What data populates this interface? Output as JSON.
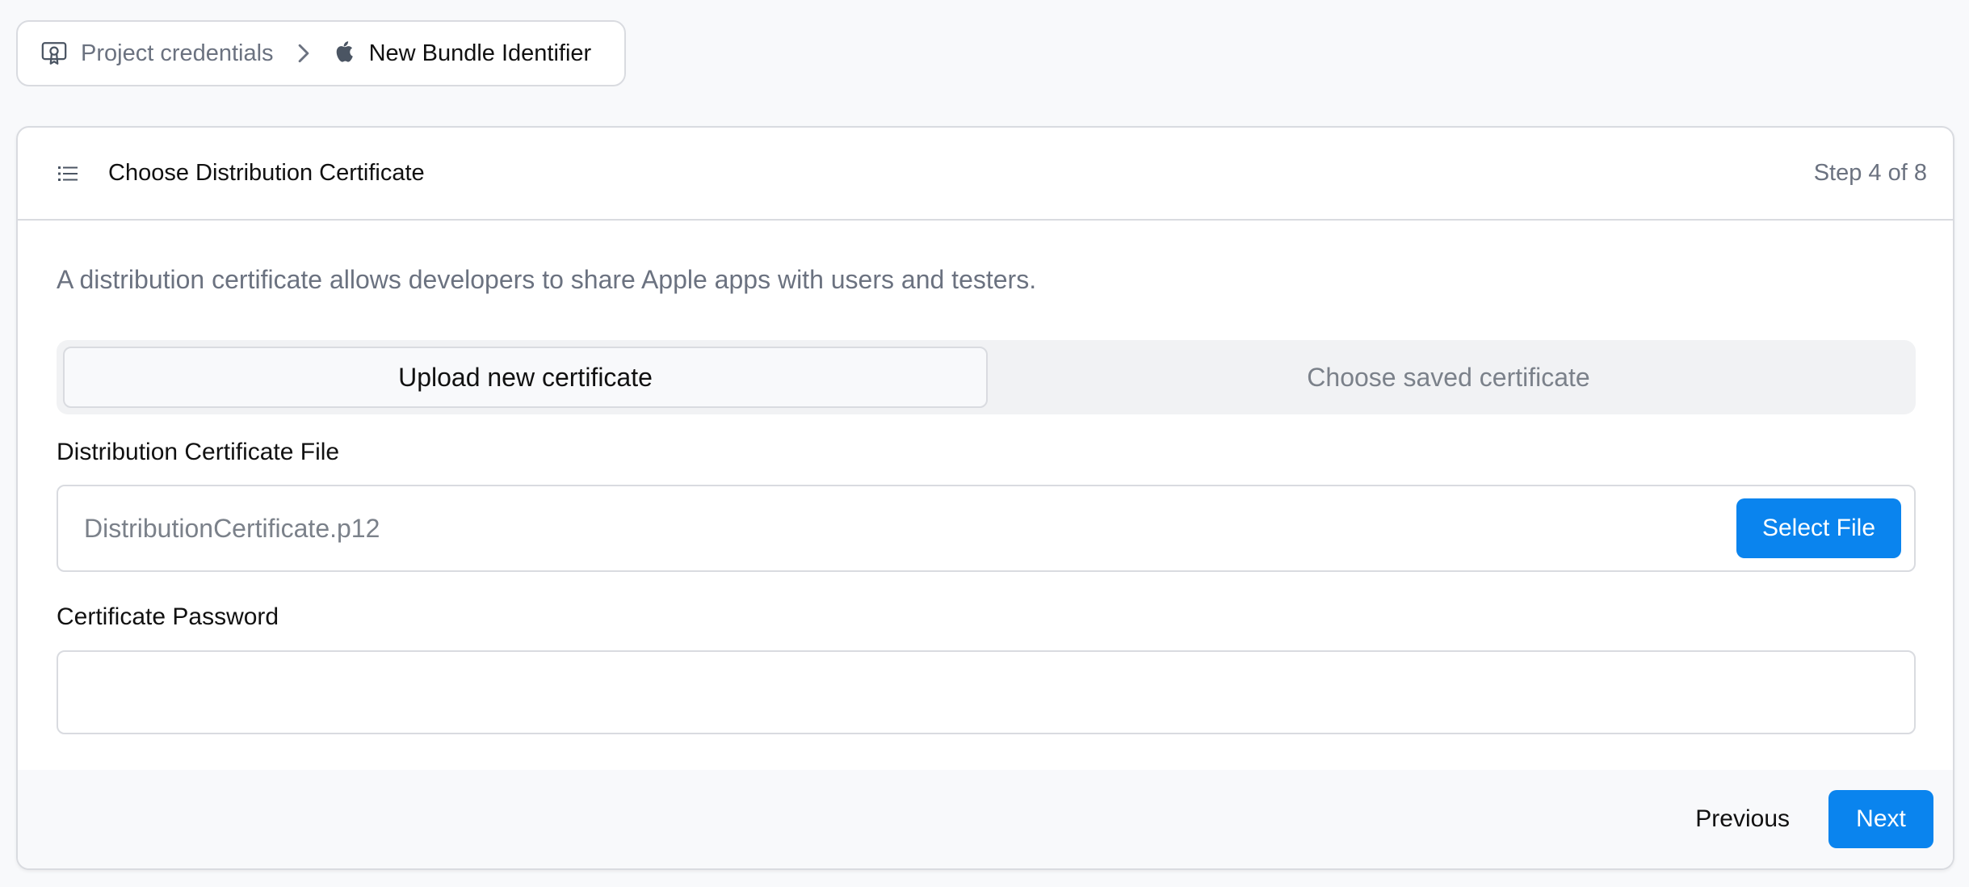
{
  "breadcrumb": {
    "items": [
      {
        "label": "Project credentials",
        "icon": "certificate-icon"
      },
      {
        "label": "New Bundle Identifier",
        "icon": "apple-icon"
      }
    ],
    "separator_icon": "chevron-right-icon"
  },
  "card": {
    "icon": "list-icon",
    "title": "Choose Distribution Certificate",
    "step": "Step 4 of 8",
    "description": "A distribution certificate allows developers to share Apple apps with users and testers.",
    "tabs": [
      {
        "label": "Upload new certificate",
        "active": true
      },
      {
        "label": "Choose saved certificate",
        "active": false
      }
    ],
    "file_field": {
      "label": "Distribution Certificate File",
      "value": "DistributionCertificate.p12",
      "button_label": "Select File"
    },
    "password_field": {
      "label": "Certificate Password",
      "value": ""
    },
    "footer": {
      "previous_label": "Previous",
      "next_label": "Next"
    }
  },
  "colors": {
    "accent": "#0a84ee",
    "background": "#f8f9fb",
    "border": "#d9dbe0",
    "muted_text": "#6b7280"
  }
}
